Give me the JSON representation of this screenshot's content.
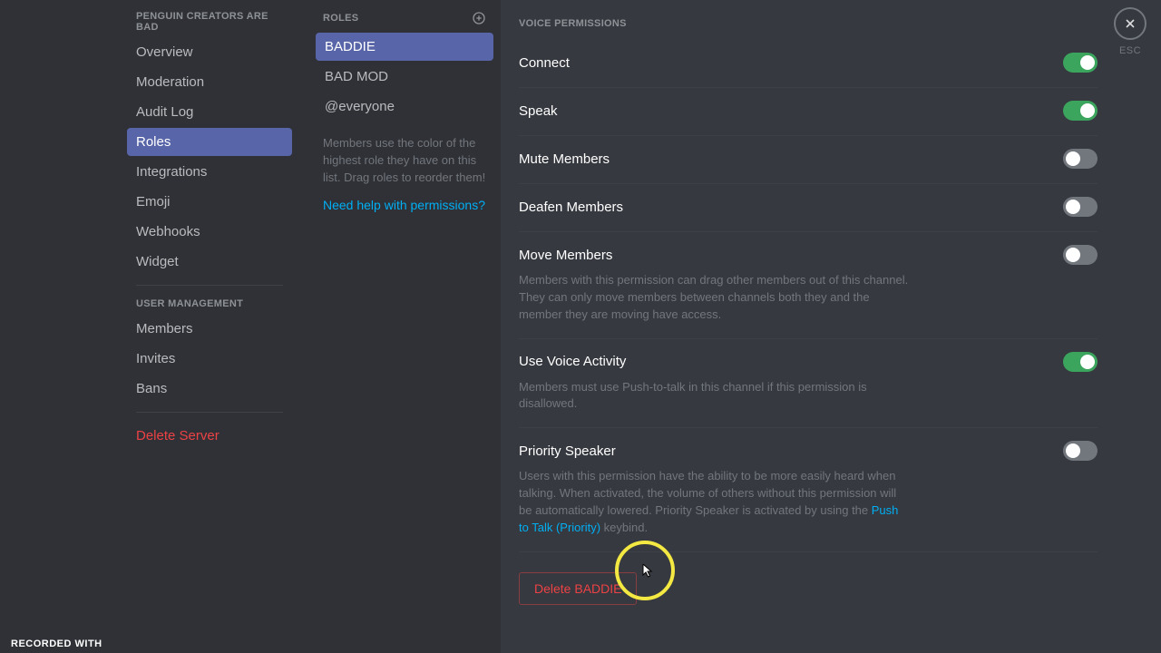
{
  "sidebar": {
    "serverHeader": "PENGUIN CREATORS ARE BAD",
    "items": [
      {
        "label": "Overview",
        "active": false
      },
      {
        "label": "Moderation",
        "active": false
      },
      {
        "label": "Audit Log",
        "active": false
      },
      {
        "label": "Roles",
        "active": true
      },
      {
        "label": "Integrations",
        "active": false
      },
      {
        "label": "Emoji",
        "active": false
      },
      {
        "label": "Webhooks",
        "active": false
      },
      {
        "label": "Widget",
        "active": false
      }
    ],
    "userMgmtHeader": "USER MANAGEMENT",
    "userItems": [
      {
        "label": "Members"
      },
      {
        "label": "Invites"
      },
      {
        "label": "Bans"
      }
    ],
    "deleteServer": "Delete Server"
  },
  "roles": {
    "header": "ROLES",
    "items": [
      {
        "label": "BADDIE",
        "selected": true
      },
      {
        "label": "BAD MOD",
        "selected": false
      },
      {
        "label": "@everyone",
        "selected": false
      }
    ],
    "hint": "Members use the color of the highest role they have on this list. Drag roles to reorder them!",
    "helpLink": "Need help with permissions?"
  },
  "main": {
    "sectionTitle": "VOICE PERMISSIONS",
    "perms": {
      "connect": {
        "title": "Connect",
        "on": true
      },
      "speak": {
        "title": "Speak",
        "on": true
      },
      "mute": {
        "title": "Mute Members",
        "on": false
      },
      "deafen": {
        "title": "Deafen Members",
        "on": false
      },
      "move": {
        "title": "Move Members",
        "on": false,
        "desc": "Members with this permission can drag other members out of this channel. They can only move members between channels both they and the member they are moving have access."
      },
      "voiceActivity": {
        "title": "Use Voice Activity",
        "on": true,
        "desc": "Members must use Push-to-talk in this channel if this permission is disallowed."
      },
      "priority": {
        "title": "Priority Speaker",
        "on": false,
        "descA": "Users with this permission have the ability to be more easily heard when talking. When activated, the volume of others without this permission will be automatically lowered. Priority Speaker is activated by using the ",
        "link": "Push to Talk (Priority)",
        "descB": " keybind."
      }
    },
    "deleteRole": "Delete BADDIE"
  },
  "close": {
    "label": "ESC"
  },
  "footer": {
    "recorded": "RECORDED WITH"
  }
}
